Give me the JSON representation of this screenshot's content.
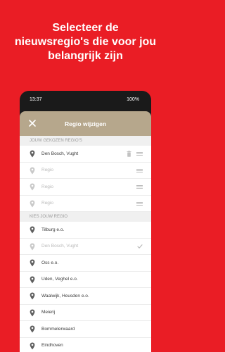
{
  "headline": "Selecteer de\nnieuwsregio's die voor jou\nbelangrijk zijn",
  "colors": {
    "brand_red": "#ea1d25",
    "appbar": "#b6a78c"
  },
  "status_bar": {
    "time": "13:37",
    "battery": "100%"
  },
  "app_bar": {
    "title": "Regio wijzigen",
    "close_icon": "close-icon"
  },
  "chosen_section": {
    "header": "JOUW GEKOZEN REGIO'S",
    "items": [
      {
        "label": "Den Bosch, Vught"
      },
      {
        "label": "Regio"
      },
      {
        "label": "Regio"
      },
      {
        "label": "Regio"
      }
    ]
  },
  "choose_section": {
    "header": "KIES JOUW REGIO",
    "items": [
      {
        "label": "Tilburg e.o."
      },
      {
        "label": "Den Bosch, Vught"
      },
      {
        "label": "Oss e.o."
      },
      {
        "label": "Uden, Veghel e.o."
      },
      {
        "label": "Waalwijk, Heusden e.o."
      },
      {
        "label": "Meierij"
      },
      {
        "label": "Bommelerwaard"
      },
      {
        "label": "Eindhoven"
      }
    ]
  }
}
